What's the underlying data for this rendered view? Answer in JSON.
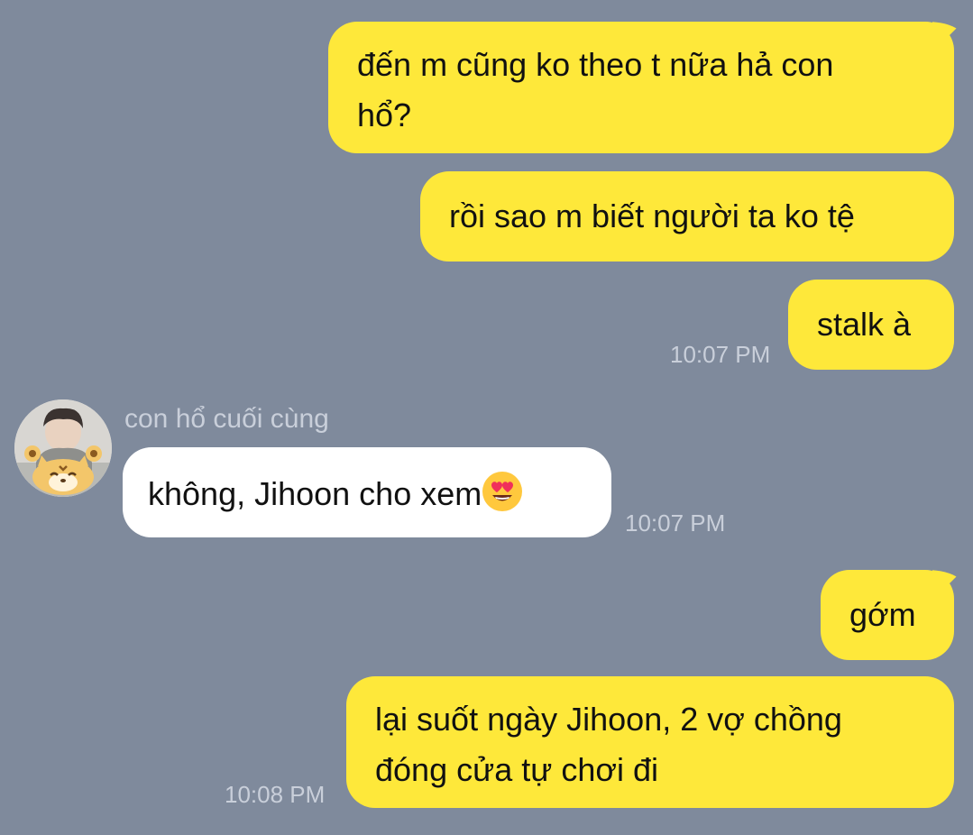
{
  "colors": {
    "background": "#7F8A9C",
    "outgoing_bubble": "#FEE83A",
    "incoming_bubble": "#FFFFFF",
    "meta_text": "#C9CFDA"
  },
  "messages": [
    {
      "direction": "outgoing",
      "lines": [
        "đến m cũng ko theo t nữa hả con",
        "hổ?"
      ]
    },
    {
      "direction": "outgoing",
      "lines": [
        "rồi sao m biết người ta ko tệ"
      ]
    },
    {
      "direction": "outgoing",
      "lines": [
        "stalk à"
      ],
      "time": "10:07 PM"
    },
    {
      "direction": "incoming",
      "sender": "con hổ cuối cùng",
      "avatar": "profile-photo-with-tiger-sticker",
      "text": "không, Jihoon cho xem",
      "emoji": "heart-eyes-emoji",
      "time": "10:07 PM"
    },
    {
      "direction": "outgoing",
      "lines": [
        "gớm"
      ]
    },
    {
      "direction": "outgoing",
      "lines": [
        "lại suốt ngày Jihoon, 2 vợ chồng",
        "đóng cửa tự chơi đi"
      ],
      "time": "10:08 PM"
    }
  ]
}
